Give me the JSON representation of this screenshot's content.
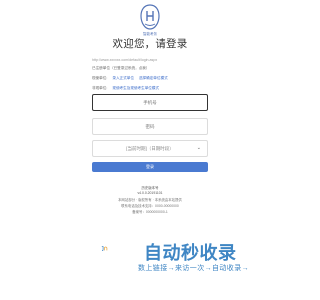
{
  "logo": {
    "caption": "智能考务"
  },
  "title": "欢迎您，请登录",
  "info": {
    "url": "http://www.xxxxxx.com/default/login.aspx",
    "line1": "已注册单位（已登录过系统，点我）",
    "line2_label": "现使单位:",
    "line2_link1": "录入正式单位",
    "line2_link2": "选择确定单位模式",
    "line3_label": "非现单位:",
    "line3_link": "现使考生及现使考生单位模式"
  },
  "form": {
    "phone_placeholder": "手机号",
    "password_placeholder": "密码",
    "period_selected": "[当前时期]（日期时段）",
    "login_label": "登录"
  },
  "footer": {
    "line1": "历史版本号",
    "line2": "v4.0.0.20191101",
    "line3": "本网站部分 · 版权所有 · 本系统由本站提供",
    "line4": "联系电话及技术支持：0000-00000000",
    "line5": "备案号：0000000000-1"
  },
  "watermark": {
    "main": "自动秒收录",
    "sub": "数上链接→来访一次→自动收录→"
  },
  "colors": {
    "accent": "#4a7ad1",
    "watermark": "#3f86c4"
  }
}
